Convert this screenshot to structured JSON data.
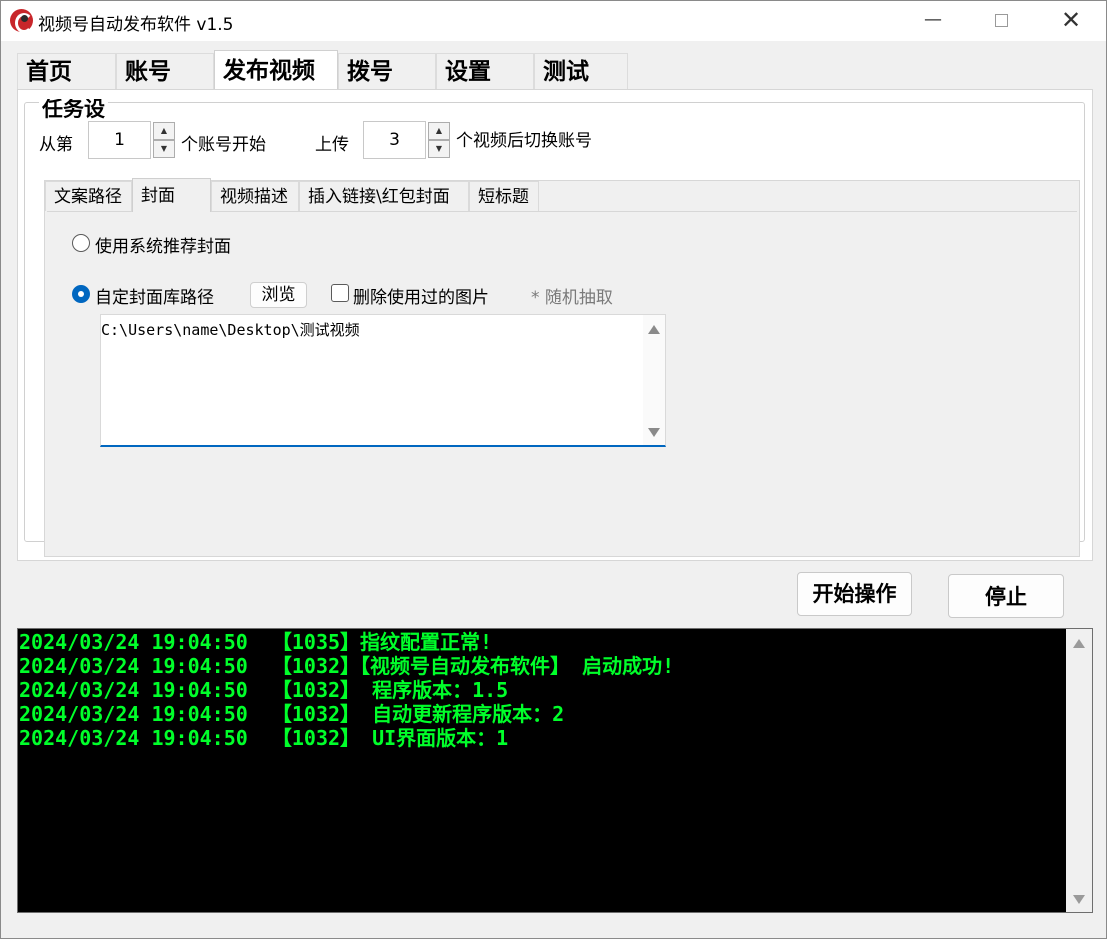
{
  "window": {
    "title": "视频号自动发布软件  v1.5",
    "minimize_glyph": "—",
    "close_glyph": "✕"
  },
  "main_tabs": [
    {
      "label": "首页"
    },
    {
      "label": "账号"
    },
    {
      "label": "发布视频",
      "active": true
    },
    {
      "label": "拨号"
    },
    {
      "label": "设置"
    },
    {
      "label": "测试"
    }
  ],
  "task_settings": {
    "group_title": "任务设",
    "from_label": "从第",
    "start_account_value": "1",
    "account_start_label": "个账号开始",
    "upload_label": "上传",
    "videos_per_account_value": "3",
    "switch_account_label": "个视频后切换账号"
  },
  "sub_tabs": [
    {
      "label": "文案路径"
    },
    {
      "label": "封面",
      "active": true
    },
    {
      "label": "视频描述"
    },
    {
      "label": "插入链接\\红包封面"
    },
    {
      "label": "短标题"
    }
  ],
  "cover": {
    "option_system": "使用系统推荐封面",
    "option_custom": "自定封面库路径",
    "selected_option": "custom",
    "browse_label": "浏览",
    "delete_used_label": "删除使用过的图片",
    "delete_used_checked": false,
    "random_hint": "* 随机抽取",
    "path_value": "C:\\Users\\name\\Desktop\\测试视频"
  },
  "actions": {
    "start_label": "开始操作",
    "stop_label": "停止"
  },
  "log": {
    "text_color": "#00ff2a",
    "lines": [
      "2024/03/24 19:04:50  【1035】指纹配置正常!",
      "2024/03/24 19:04:50  【1032】【视频号自动发布软件】 启动成功!",
      "2024/03/24 19:04:50  【1032】 程序版本：1.5",
      "2024/03/24 19:04:50  【1032】 自动更新程序版本：2",
      "2024/03/24 19:04:50  【1032】 UI界面版本：1"
    ]
  },
  "colors": {
    "accent": "#0067c0",
    "console_bg": "#000000",
    "app_icon": "#c8262a"
  }
}
